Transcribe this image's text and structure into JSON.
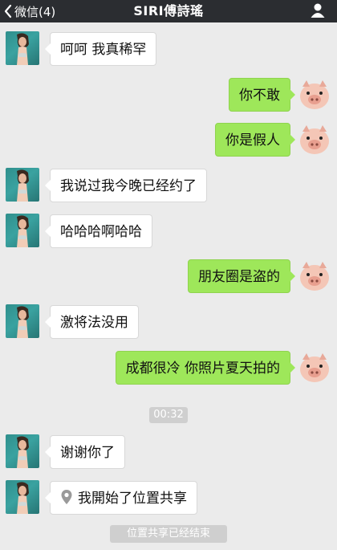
{
  "header": {
    "back_label": "微信(4)",
    "title": "SIRI傅詩瑤",
    "back_icon": "chevron-left-icon",
    "profile_icon": "person-icon"
  },
  "messages": [
    {
      "side": "left",
      "text": "呵呵 我真稀罕"
    },
    {
      "side": "right",
      "text": "你不敢"
    },
    {
      "side": "right",
      "text": "你是假人"
    },
    {
      "side": "left",
      "text": "我说过我今晚已经约了"
    },
    {
      "side": "left",
      "text": "哈哈哈啊哈哈"
    },
    {
      "side": "right",
      "text": "朋友圈是盗的"
    },
    {
      "side": "left",
      "text": "激将法没用"
    },
    {
      "side": "right",
      "text": "成都很冷 你照片夏天拍的"
    },
    {
      "side": "left",
      "text": "谢谢你了"
    },
    {
      "side": "left",
      "text": "我開始了位置共享",
      "icon": "location-pin-icon"
    }
  ],
  "timestamp": "00:32",
  "system_notice": "位置共享已经结束",
  "colors": {
    "header_bg": "#2b2d31",
    "chat_bg": "#ebebeb",
    "sent_bubble": "#9ee75a",
    "received_bubble": "#ffffff"
  }
}
